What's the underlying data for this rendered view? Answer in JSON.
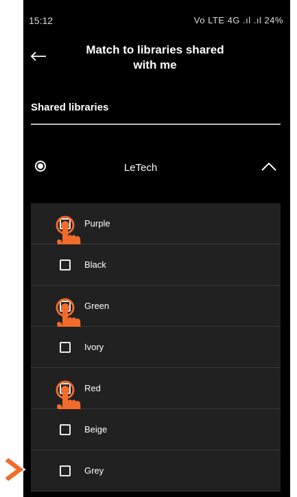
{
  "status_bar": {
    "time": "15:12",
    "indicators": "Vo LTE 4G .ıl .ıl 24%"
  },
  "header": {
    "title_line1": "Match to libraries shared",
    "title_line2": "with me"
  },
  "section": {
    "label": "Shared libraries"
  },
  "library": {
    "name": "LeTech",
    "selected": true,
    "expanded": true
  },
  "items": [
    {
      "label": "Purple",
      "checked": false,
      "highlighted": true
    },
    {
      "label": "Black",
      "checked": false,
      "highlighted": false
    },
    {
      "label": "Green",
      "checked": false,
      "highlighted": true
    },
    {
      "label": "Ivory",
      "checked": false,
      "highlighted": false
    },
    {
      "label": "Red",
      "checked": false,
      "highlighted": true
    },
    {
      "label": "Beige",
      "checked": false,
      "highlighted": false
    },
    {
      "label": "Grey",
      "checked": false,
      "highlighted": false
    }
  ],
  "colors": {
    "accent": "#f26b2a",
    "background": "#000000",
    "row": "#212121"
  }
}
